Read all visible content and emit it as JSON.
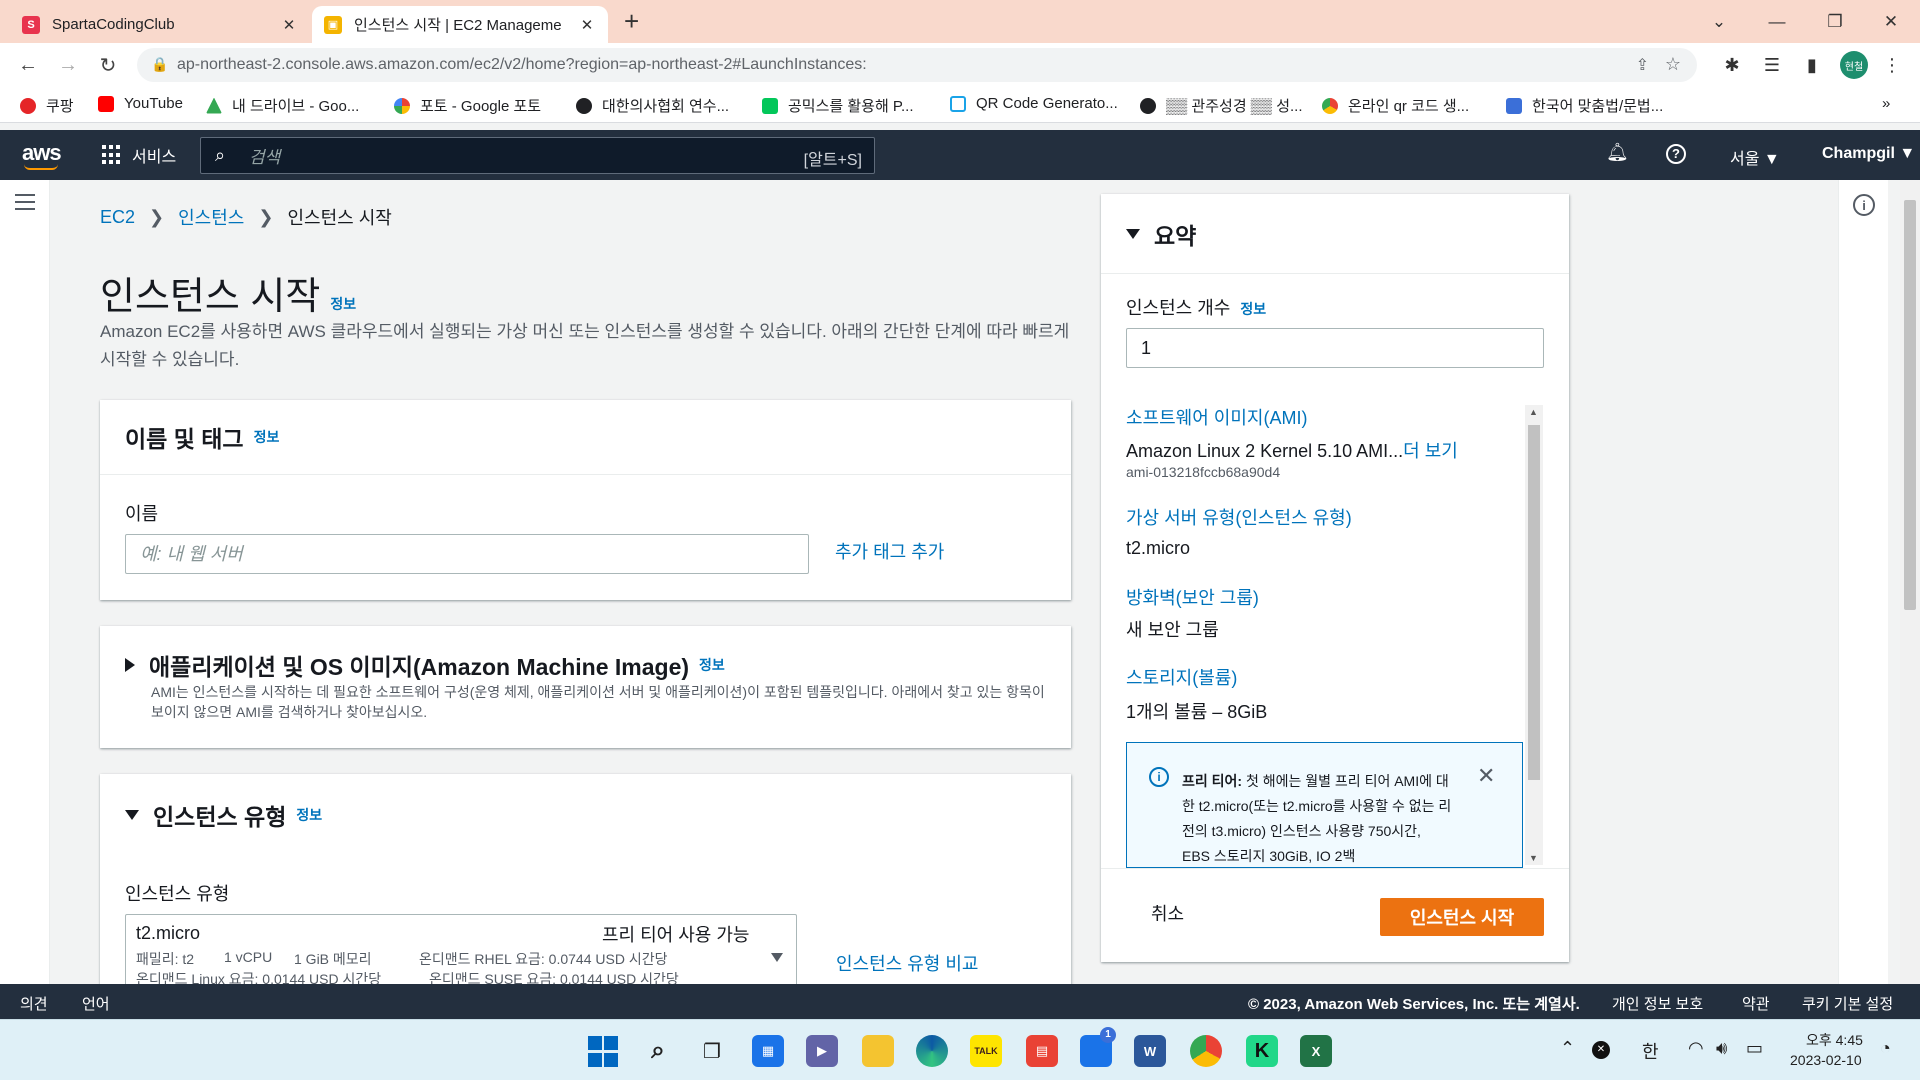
{
  "browser": {
    "tabs": [
      {
        "title": "SpartaCodingClub",
        "active": false
      },
      {
        "title": "인스턴스 시작 | EC2 Manageme",
        "active": true
      }
    ],
    "new_tab": "+",
    "url": "ap-northeast-2.console.aws.amazon.com/ec2/v2/home?region=ap-northeast-2#LaunchInstances:",
    "profile_initials": "현철",
    "bookmarks": [
      "쿠팡",
      "YouTube",
      "내 드라이브 - Goo...",
      "포토 - Google 포토",
      "대한의사협회 연수...",
      "공믹스를 활용해 P...",
      "QR Code Generato...",
      "▒▒ 관주성경 ▒▒ 성...",
      "온라인 qr 코드 생...",
      "한국어 맞춤법/문법..."
    ],
    "bookmarks_overflow": "»"
  },
  "aws_nav": {
    "logo": "aws",
    "services": "서비스",
    "search_placeholder": "검색",
    "search_shortcut": "[알트+S]",
    "region": "서울 ▼",
    "user": "Champgil ▼"
  },
  "breadcrumb": [
    "EC2",
    "인스턴스",
    "인스턴스 시작"
  ],
  "page": {
    "title": "인스턴스 시작",
    "info": "정보",
    "description": "Amazon EC2를 사용하면 AWS 클라우드에서 실행되는 가상 머신 또는 인스턴스를 생성할 수 있습니다. 아래의 간단한 단계에 따라 빠르게 시작할 수 있습니다."
  },
  "name_tags": {
    "title": "이름 및 태그",
    "info": "정보",
    "name_label": "이름",
    "name_placeholder": "예: 내 웹 서버",
    "add_tags": "추가 태그 추가"
  },
  "ami": {
    "title": "애플리케이션 및 OS 이미지(Amazon Machine Image)",
    "info": "정보",
    "description": "AMI는 인스턴스를 시작하는 데 필요한 소프트웨어 구성(운영 체제, 애플리케이션 서버 및 애플리케이션)이 포함된 템플릿입니다. 아래에서 찾고 있는 항목이 보이지 않으면 AMI를 검색하거나 찾아보십시오."
  },
  "instance_type": {
    "title": "인스턴스 유형",
    "info": "정보",
    "label": "인스턴스 유형",
    "selected": "t2.micro",
    "free_tier": "프리 티어 사용 가능",
    "line1a": "패밀리: t2",
    "line1b": "1 vCPU",
    "line1c": "1 GiB 메모리",
    "line1d": "온디맨드 RHEL 요금: 0.0744 USD 시간당",
    "line2a": "온디맨드 Linux 요금: 0.0144 USD 시간당",
    "line2b": "온디맨드 SUSE 요금: 0.0144 USD 시간당",
    "compare": "인스턴스 유형 비교"
  },
  "summary": {
    "title": "요약",
    "count_label": "인스턴스 개수",
    "info": "정보",
    "count_value": "1",
    "ami_label": "소프트웨어 이미지(AMI)",
    "ami_value": "Amazon Linux 2 Kernel 5.10 AMI...",
    "ami_more": "더 보기",
    "ami_id": "ami-013218fccb68a90d4",
    "type_label": "가상 서버 유형(인스턴스 유형)",
    "type_value": "t2.micro",
    "firewall_label": "방화벽(보안 그룹)",
    "firewall_value": "새 보안 그룹",
    "storage_label": "스토리지(볼륨)",
    "storage_value": "1개의 볼륨 – 8GiB",
    "free_tier_bold": "프리 티어:",
    "free_tier_text": " 첫 해에는 월별 프리 티어 AMI에 대한 t2.micro(또는 t2.micro를 사용할 수 없는 리전의 t3.micro) 인스턴스 사용량 750시간, EBS 스토리지 30GiB, IO 2백",
    "cancel": "취소",
    "launch": "인스턴스 시작"
  },
  "footer": {
    "feedback": "의견",
    "language": "언어",
    "copyright": "© 2023, Amazon Web Services, Inc. 또는 계열사.",
    "privacy": "개인 정보 보호",
    "terms": "약관",
    "cookies": "쿠키 기본 설정"
  },
  "taskbar": {
    "time": "오후 4:45",
    "date": "2023-02-10",
    "ime": "한",
    "chat_badge": "1"
  },
  "colors": {
    "aws_nav": "#232f3e",
    "link": "#0073bb",
    "launch": "#ec7211",
    "tabbar": "#f9d9cc"
  }
}
